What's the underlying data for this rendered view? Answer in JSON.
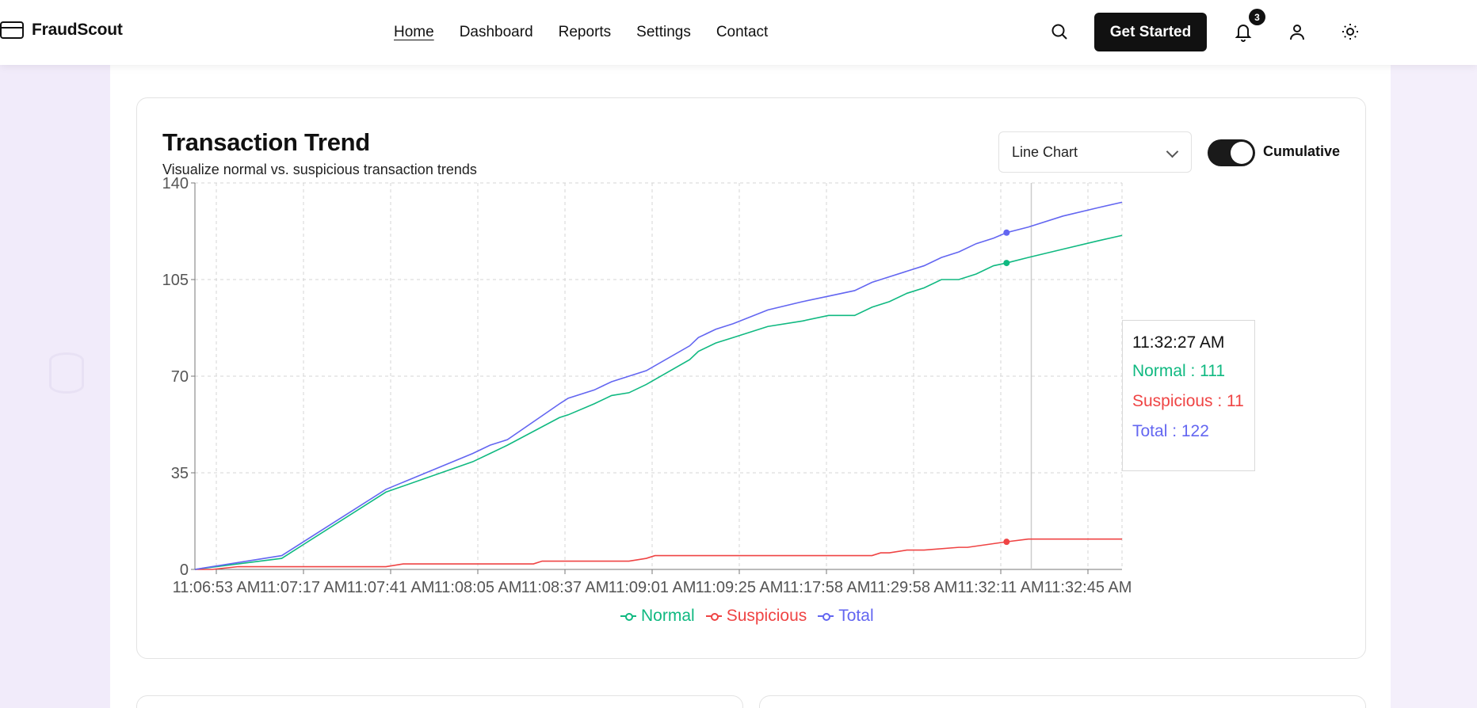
{
  "header": {
    "logo_text": "FraudScout",
    "nav": [
      "Home",
      "Dashboard",
      "Reports",
      "Settings",
      "Contact"
    ],
    "cta_label": "Get Started",
    "notification_count": "3"
  },
  "card": {
    "title": "Transaction Trend",
    "subtitle": "Visualize normal vs. suspicious transaction trends",
    "chart_type_select": "Line Chart",
    "toggle_label": "Cumulative",
    "toggle_on": true
  },
  "tooltip": {
    "time": "11:32:27 AM",
    "normal": "Normal : 111",
    "suspicious": "Suspicious : 11",
    "total": "Total : 122"
  },
  "colors": {
    "normal": "#10b981",
    "suspicious": "#ef4444",
    "total": "#6366f1"
  },
  "chart_data": {
    "type": "line",
    "ylim": [
      0,
      140
    ],
    "yticks": [
      0,
      35,
      70,
      105,
      140
    ],
    "xticks": [
      "11:06:53 AM",
      "11:07:17 AM",
      "11:07:41 AM",
      "11:08:05 AM",
      "11:08:37 AM",
      "11:09:01 AM",
      "11:09:25 AM",
      "11:17:58 AM",
      "11:29:58 AM",
      "11:32:11 AM",
      "11:32:45 AM"
    ],
    "grid": true,
    "legend": "bottom-center",
    "series": [
      {
        "name": "Normal",
        "x": [
          0,
          10,
          22,
          32,
          34,
          36,
          42,
          43,
          46,
          48,
          50,
          52,
          57,
          58,
          60,
          62,
          66,
          70,
          73,
          76,
          78,
          80,
          82,
          84,
          86,
          88,
          90,
          92,
          93.5,
          96,
          100,
          104,
          106.8
        ],
        "values": [
          0,
          4,
          28,
          39,
          42,
          45,
          55,
          56,
          60,
          63,
          64,
          67,
          76,
          79,
          82,
          84,
          88,
          90,
          92,
          92,
          95,
          97,
          100,
          102,
          105,
          105,
          107,
          110,
          111,
          113,
          116,
          119,
          121
        ]
      },
      {
        "name": "Suspicious",
        "x": [
          0,
          2,
          5,
          22,
          24,
          30,
          39,
          40,
          50,
          52,
          53,
          60,
          70,
          78,
          79,
          80,
          82,
          84,
          88,
          89,
          93.5,
          96,
          100,
          104,
          106.8
        ],
        "values": [
          0,
          0,
          1,
          1,
          2,
          2,
          2,
          3,
          3,
          4,
          5,
          5,
          5,
          5,
          6,
          6,
          7,
          7,
          8,
          8,
          10,
          11,
          11,
          11,
          11
        ]
      },
      {
        "name": "Total",
        "x": [
          0,
          10,
          22,
          32,
          34,
          36,
          42,
          43,
          46,
          48,
          50,
          52,
          57,
          58,
          60,
          62,
          66,
          70,
          73,
          76,
          78,
          80,
          82,
          84,
          86,
          88,
          90,
          92,
          93.5,
          96,
          100,
          104,
          106.8
        ],
        "values": [
          0,
          5,
          29,
          42,
          45,
          47,
          60,
          62,
          65,
          68,
          70,
          72,
          81,
          84,
          87,
          89,
          94,
          97,
          99,
          101,
          104,
          106,
          108,
          110,
          113,
          115,
          118,
          120,
          122,
          124,
          128,
          131,
          133
        ]
      }
    ]
  }
}
